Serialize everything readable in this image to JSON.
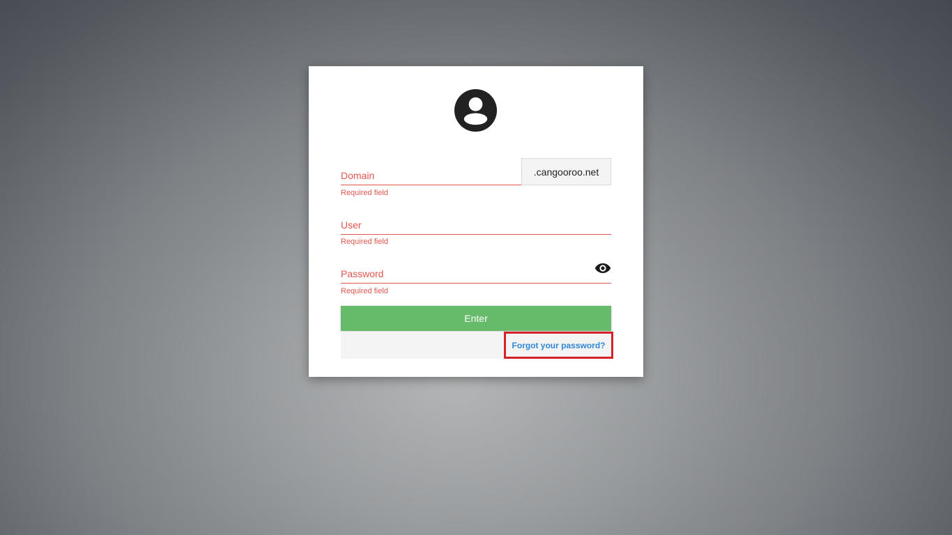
{
  "form": {
    "domain": {
      "label": "Domain",
      "error": "Required field",
      "suffix": ".cangooroo.net"
    },
    "user": {
      "label": "User",
      "error": "Required field"
    },
    "password": {
      "label": "Password",
      "error": "Required field"
    },
    "enter_label": "Enter",
    "forgot_label": "Forgot your password?"
  },
  "icons": {
    "avatar": "account-circle-icon",
    "password_toggle": "eye-icon"
  },
  "colors": {
    "error": "#e0554f",
    "primary_button": "#66bb6a",
    "link": "#2f86d6",
    "highlight_border": "#d3222a"
  }
}
